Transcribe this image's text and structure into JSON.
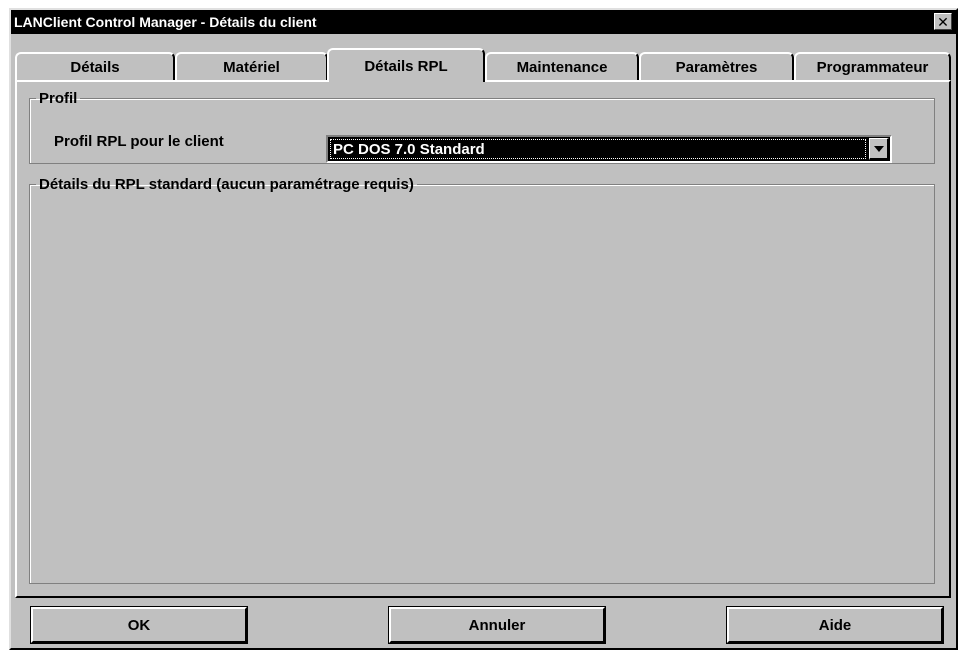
{
  "window": {
    "title": "LANClient Control Manager - Détails du client",
    "close_label": "✕"
  },
  "tabs": [
    {
      "label": "Détails",
      "active": false
    },
    {
      "label": "Matériel",
      "active": false
    },
    {
      "label": "Détails RPL",
      "active": true
    },
    {
      "label": "Maintenance",
      "active": false
    },
    {
      "label": "Paramètres",
      "active": false
    },
    {
      "label": "Programmateur",
      "active": false
    }
  ],
  "profil_group": {
    "legend": "Profil",
    "field_label": "Profil RPL pour le client",
    "selected_value": "PC DOS 7.0 Standard"
  },
  "details_group": {
    "legend": "Détails du RPL standard (aucun paramétrage requis)"
  },
  "buttons": {
    "ok": "OK",
    "cancel": "Annuler",
    "help": "Aide"
  }
}
